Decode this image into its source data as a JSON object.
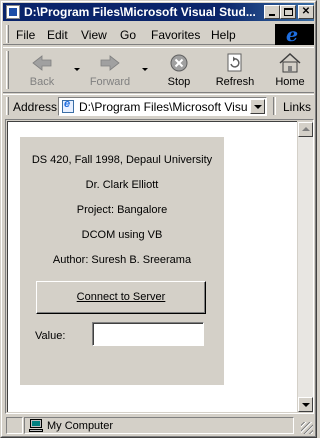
{
  "window": {
    "title": "D:\\Program Files\\Microsoft Visual Stud..."
  },
  "menu": {
    "items": [
      {
        "label": "File"
      },
      {
        "label": "Edit"
      },
      {
        "label": "View"
      },
      {
        "label": "Go"
      },
      {
        "label": "Favorites"
      },
      {
        "label": "Help"
      }
    ]
  },
  "toolbar": {
    "back": "Back",
    "forward": "Forward",
    "stop": "Stop",
    "refresh": "Refresh",
    "home": "Home"
  },
  "address": {
    "label": "Address",
    "value": "D:\\Program Files\\Microsoft Visual S",
    "links_label": "Links"
  },
  "applet": {
    "lines": [
      "DS 420, Fall 1998, Depaul University",
      "Dr. Clark Elliott",
      "Project: Bangalore",
      "DCOM using VB",
      "Author: Suresh B. Sreerama"
    ],
    "connect_button": "Connect to Server",
    "value_label": "Value:",
    "value": ""
  },
  "status": {
    "zone": "My Computer"
  },
  "colors": {
    "titlebar": "#0a246a",
    "face": "#d4d0c8",
    "content_bg": "#ffffff"
  }
}
